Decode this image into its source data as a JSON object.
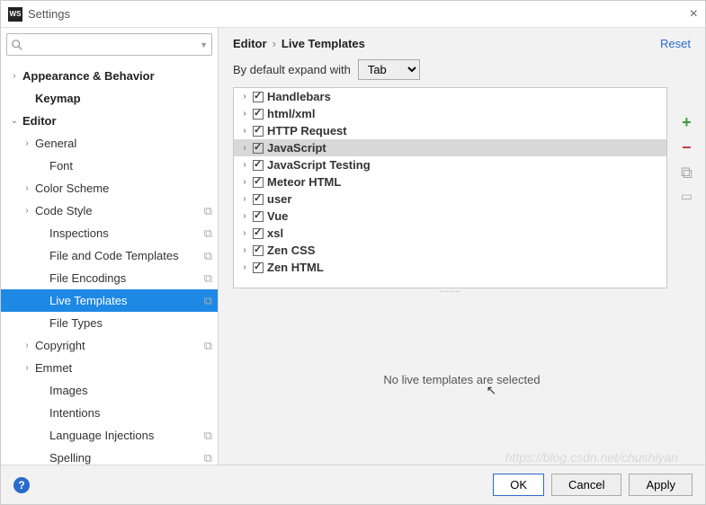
{
  "window": {
    "title": "Settings"
  },
  "search": {
    "placeholder": ""
  },
  "sidebar": [
    {
      "label": "Appearance & Behavior",
      "bold": true,
      "exp": "›",
      "indent": 0,
      "copy": false,
      "sel": false
    },
    {
      "label": "Keymap",
      "bold": true,
      "exp": "",
      "indent": 1,
      "copy": false,
      "sel": false
    },
    {
      "label": "Editor",
      "bold": true,
      "exp": "⌄",
      "indent": 0,
      "copy": false,
      "sel": false
    },
    {
      "label": "General",
      "bold": false,
      "exp": "›",
      "indent": 1,
      "copy": false,
      "sel": false
    },
    {
      "label": "Font",
      "bold": false,
      "exp": "",
      "indent": 2,
      "copy": false,
      "sel": false
    },
    {
      "label": "Color Scheme",
      "bold": false,
      "exp": "›",
      "indent": 1,
      "copy": false,
      "sel": false
    },
    {
      "label": "Code Style",
      "bold": false,
      "exp": "›",
      "indent": 1,
      "copy": true,
      "sel": false
    },
    {
      "label": "Inspections",
      "bold": false,
      "exp": "",
      "indent": 2,
      "copy": true,
      "sel": false
    },
    {
      "label": "File and Code Templates",
      "bold": false,
      "exp": "",
      "indent": 2,
      "copy": true,
      "sel": false
    },
    {
      "label": "File Encodings",
      "bold": false,
      "exp": "",
      "indent": 2,
      "copy": true,
      "sel": false
    },
    {
      "label": "Live Templates",
      "bold": false,
      "exp": "",
      "indent": 2,
      "copy": true,
      "sel": true
    },
    {
      "label": "File Types",
      "bold": false,
      "exp": "",
      "indent": 2,
      "copy": false,
      "sel": false
    },
    {
      "label": "Copyright",
      "bold": false,
      "exp": "›",
      "indent": 1,
      "copy": true,
      "sel": false
    },
    {
      "label": "Emmet",
      "bold": false,
      "exp": "›",
      "indent": 1,
      "copy": false,
      "sel": false
    },
    {
      "label": "Images",
      "bold": false,
      "exp": "",
      "indent": 2,
      "copy": false,
      "sel": false
    },
    {
      "label": "Intentions",
      "bold": false,
      "exp": "",
      "indent": 2,
      "copy": false,
      "sel": false
    },
    {
      "label": "Language Injections",
      "bold": false,
      "exp": "",
      "indent": 2,
      "copy": true,
      "sel": false
    },
    {
      "label": "Spelling",
      "bold": false,
      "exp": "",
      "indent": 2,
      "copy": true,
      "sel": false
    }
  ],
  "breadcrumb": {
    "a": "Editor",
    "b": "Live Templates",
    "reset": "Reset"
  },
  "option": {
    "label": "By default expand with",
    "value": "Tab"
  },
  "templates": [
    {
      "label": "Handlebars",
      "checked": true,
      "hl": false
    },
    {
      "label": "html/xml",
      "checked": true,
      "hl": false
    },
    {
      "label": "HTTP Request",
      "checked": true,
      "hl": false
    },
    {
      "label": "JavaScript",
      "checked": true,
      "hl": true
    },
    {
      "label": "JavaScript Testing",
      "checked": true,
      "hl": false
    },
    {
      "label": "Meteor HTML",
      "checked": true,
      "hl": false
    },
    {
      "label": "user",
      "checked": true,
      "hl": false
    },
    {
      "label": "Vue",
      "checked": true,
      "hl": false
    },
    {
      "label": "xsl",
      "checked": true,
      "hl": false
    },
    {
      "label": "Zen CSS",
      "checked": true,
      "hl": false
    },
    {
      "label": "Zen HTML",
      "checked": true,
      "hl": false
    }
  ],
  "detail": {
    "empty": "No live templates are selected"
  },
  "footer": {
    "ok": "OK",
    "cancel": "Cancel",
    "apply": "Apply"
  }
}
